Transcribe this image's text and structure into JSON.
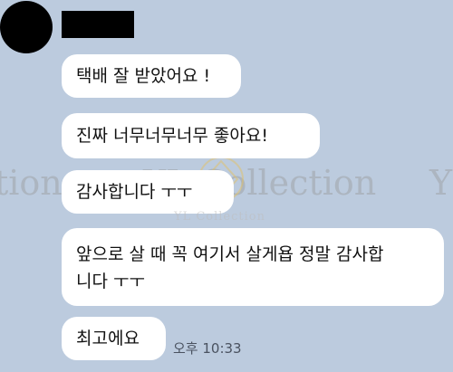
{
  "chat": {
    "messages": [
      {
        "text": "택배 잘 받았어요 !"
      },
      {
        "text": "진짜 너무너무너무 좋아요!"
      },
      {
        "text": "감사합니다 ㅜㅜ"
      },
      {
        "text": "앞으로 살 때 꼭 여기서 살게욥 정말 감사합\n니다 ㅜㅜ"
      },
      {
        "text": "최고에요"
      }
    ],
    "timestamp": "오후 10:33"
  },
  "watermark": {
    "text_left": "tion",
    "text_center": "YL Collection",
    "text_right": "Y",
    "sub": "YL Collection"
  },
  "colors": {
    "background": "#bccbde",
    "bubble": "#ffffff",
    "redaction": "#000000"
  }
}
